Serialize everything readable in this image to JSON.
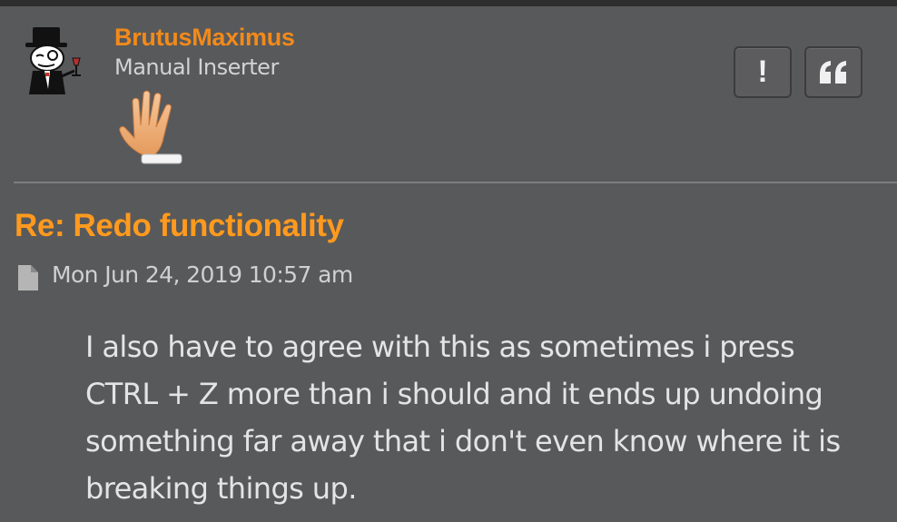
{
  "author": {
    "username": "BrutusMaximus",
    "rank": "Manual Inserter",
    "avatar_icon": "gentleman-top-hat-avatar",
    "rank_icon": "raised-hand-icon"
  },
  "actions": {
    "report_label": "!",
    "quote_icon": "quote-icon"
  },
  "post": {
    "title": "Re: Redo functionality",
    "date": "Mon Jun 24, 2019 10:57 am",
    "date_icon": "document-icon",
    "body_lines": [
      "I also have to agree with this as sometimes i press",
      "CTRL + Z more than i should and it ends up undoing",
      "something far away that i don't even know where it is",
      "breaking things up."
    ]
  },
  "colors": {
    "background": "#58595b",
    "username": "#f28a1a",
    "title": "#ff9a1e",
    "text": "#e4e4e4"
  }
}
